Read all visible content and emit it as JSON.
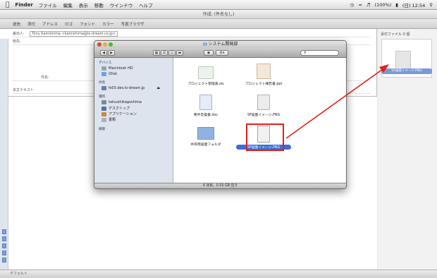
{
  "menubar": {
    "app": "Finder",
    "items": [
      "ファイル",
      "編集",
      "表示",
      "移動",
      "ウインドウ",
      "ヘルプ"
    ],
    "clock": "(日) 12:54",
    "battery": "(100%)"
  },
  "mail": {
    "window_title": "作成: (件名なし)",
    "toolbar": [
      "送信",
      "添付",
      "アドレス",
      "ロゴ",
      "フォント",
      "カラー",
      "写真ブラウザ"
    ],
    "from_label": "差出人:",
    "from_value": "Tony Kamishima <kamishima@io-dream.co.jp>",
    "to_label": "宛先:",
    "subject_label": "件名:",
    "body_label": "本文テキスト",
    "attachment_header": "添付ファイル 0 個",
    "attachment_name": "SP画面イメージ.PNG",
    "statusbar": "デフォルト"
  },
  "finder": {
    "title": "システム開発部",
    "status": "6 項目、0.00 GB 空き",
    "search_placeholder": "",
    "sidebar": [
      {
        "header": "デバイス"
      },
      {
        "label": "Macintosh HD",
        "icon": "hard-disk-icon"
      },
      {
        "label": "iDisk",
        "icon": "idisk-icon"
      },
      {
        "header": "共有"
      },
      {
        "label": "fs03.dev.io-dream.jp",
        "icon": "server-icon"
      },
      {
        "header": "場所"
      },
      {
        "label": "tatsushikagoshima",
        "icon": "home-icon"
      },
      {
        "label": "デスクトップ",
        "icon": "desktop-icon"
      },
      {
        "label": "アプリケーション",
        "icon": "applications-icon"
      },
      {
        "label": "書類",
        "icon": "documents-icon"
      },
      {
        "header": "検索"
      }
    ],
    "files": [
      {
        "name": "プロジェクト管理表.xls",
        "icon": "xls-file-icon"
      },
      {
        "name": "プロジェクト報告書.ppt",
        "icon": "ppt-file-icon"
      },
      {
        "name": "要件定義書.doc",
        "icon": "doc-file-icon"
      },
      {
        "name": "SP画面イメージ.PNG",
        "icon": "png-file-icon"
      },
      {
        "name": "共有用画面フォルダ",
        "icon": "folder-icon"
      },
      {
        "name": "SP画面イメージ.PNG",
        "icon": "png-file-icon",
        "selected": true
      }
    ]
  },
  "colors": {
    "highlight": "#e0201b",
    "selection": "#3b6fd4",
    "sidebar": "#dde4ee"
  }
}
